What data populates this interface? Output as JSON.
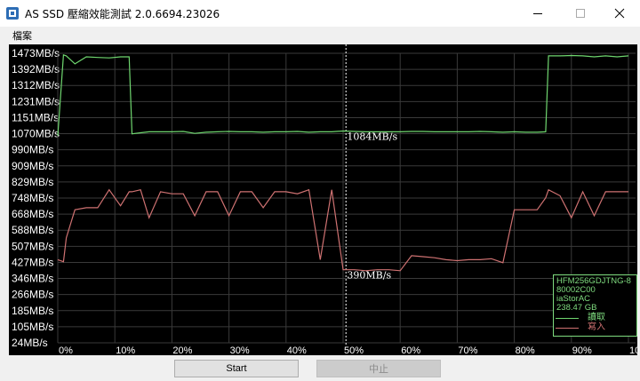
{
  "window": {
    "title": "AS SSD 壓縮效能測試 2.0.6694.23026"
  },
  "menu": {
    "items": [
      "檔案"
    ]
  },
  "chart_data": {
    "type": "line",
    "y_labels": [
      "1473MB/s",
      "1392MB/s",
      "1312MB/s",
      "1231MB/s",
      "1151MB/s",
      "1070MB/s",
      "990MB/s",
      "909MB/s",
      "829MB/s",
      "748MB/s",
      "668MB/s",
      "588MB/s",
      "507MB/s",
      "427MB/s",
      "346MB/s",
      "266MB/s",
      "185MB/s",
      "105MB/s",
      "24MB/s"
    ],
    "x_labels": [
      "0%",
      "10%",
      "20%",
      "30%",
      "40%",
      "50%",
      "60%",
      "70%",
      "80%",
      "90%",
      "100%"
    ],
    "ylim": [
      24,
      1473
    ],
    "xlim": [
      0,
      100
    ],
    "x": [
      0,
      1,
      1.5,
      3,
      5,
      7,
      9,
      11,
      12.5,
      13,
      14.5,
      16,
      18,
      20,
      22,
      24,
      26,
      28,
      30,
      32,
      34,
      36,
      38,
      40,
      42,
      44,
      46,
      48,
      50,
      52,
      54,
      56,
      58,
      60,
      62,
      64,
      66,
      68,
      70,
      72,
      74,
      76,
      78,
      80,
      82,
      84,
      85.5,
      86,
      88,
      90,
      92,
      94,
      96,
      98,
      100
    ],
    "series": [
      {
        "name": "讀取",
        "color": "#6fd66f",
        "values": [
          1060,
          1465,
          1460,
          1420,
          1455,
          1452,
          1450,
          1455,
          1455,
          1070,
          1075,
          1080,
          1080,
          1080,
          1082,
          1072,
          1078,
          1080,
          1082,
          1080,
          1080,
          1078,
          1080,
          1080,
          1082,
          1078,
          1080,
          1080,
          1084,
          1082,
          1080,
          1080,
          1080,
          1080,
          1082,
          1082,
          1080,
          1080,
          1080,
          1080,
          1082,
          1080,
          1078,
          1080,
          1078,
          1078,
          1080,
          1460,
          1460,
          1462,
          1460,
          1455,
          1460,
          1455,
          1460
        ]
      },
      {
        "name": "寫入",
        "color": "#cf7272",
        "values": [
          440,
          430,
          550,
          690,
          700,
          700,
          790,
          710,
          780,
          780,
          790,
          650,
          780,
          770,
          770,
          660,
          780,
          780,
          660,
          780,
          780,
          700,
          780,
          780,
          770,
          790,
          440,
          790,
          390,
          390,
          385,
          390,
          390,
          385,
          460,
          455,
          450,
          440,
          435,
          440,
          440,
          445,
          425,
          690,
          690,
          690,
          750,
          790,
          760,
          650,
          780,
          660,
          780,
          780,
          780
        ]
      }
    ],
    "markers": [
      {
        "x": 51,
        "label": "1084MB/s"
      },
      {
        "x": 51,
        "label": "390MB/s"
      }
    ],
    "cursor_x": 50.5
  },
  "legend": {
    "drive_model": "HFM256GDJTNG-8",
    "firmware": "80002C00",
    "driver": "iaStorAC",
    "capacity": "238.47 GB",
    "read_label": "讀取",
    "write_label": "寫入"
  },
  "buttons": {
    "start": "Start",
    "stop": "中止"
  },
  "colors": {
    "read": "#6fd66f",
    "write": "#cf7272",
    "grid": "#3a3a3a",
    "chart_bg": "#000000"
  }
}
